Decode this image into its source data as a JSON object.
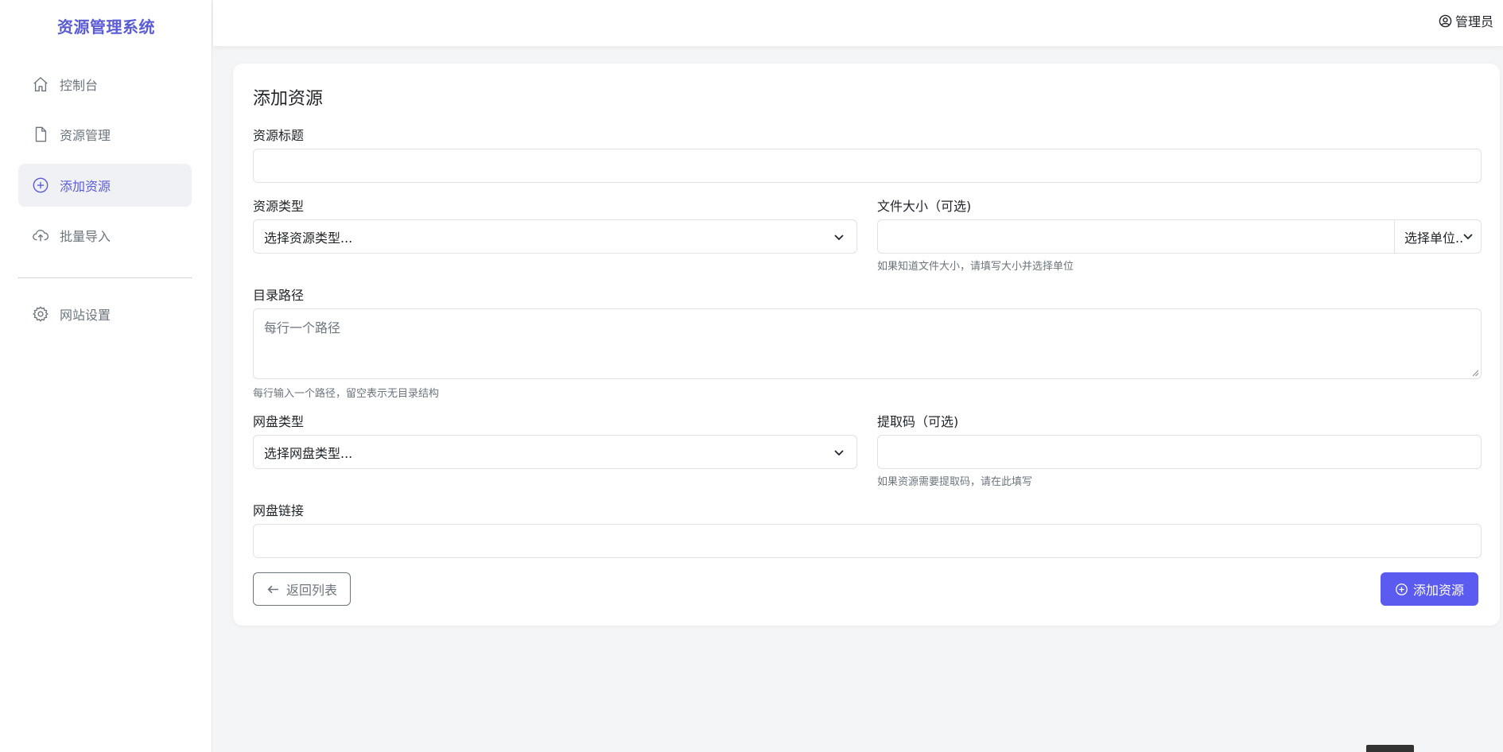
{
  "brand": "资源管理系统",
  "sidebar": {
    "items": [
      {
        "label": "控制台",
        "icon": "home-icon",
        "active": false
      },
      {
        "label": "资源管理",
        "icon": "file-icon",
        "active": false
      },
      {
        "label": "添加资源",
        "icon": "plus-circle-icon",
        "active": true
      },
      {
        "label": "批量导入",
        "icon": "cloud-upload-icon",
        "active": false
      },
      {
        "label": "网站设置",
        "icon": "gear-icon",
        "active": false
      }
    ]
  },
  "topbar": {
    "user": "管理员",
    "user_icon": "user-circle-icon"
  },
  "form": {
    "title": "添加资源",
    "resource_title": {
      "label": "资源标题",
      "value": ""
    },
    "resource_type": {
      "label": "资源类型",
      "selected": "选择资源类型..."
    },
    "file_size": {
      "label": "文件大小（可选)",
      "value": "",
      "unit_selected": "选择单位..",
      "hint": "如果知道文件大小，请填写大小并选择单位"
    },
    "dir_path": {
      "label": "目录路径",
      "placeholder": "每行一个路径",
      "hint": "每行输入一个路径，留空表示无目录结构"
    },
    "disk_type": {
      "label": "网盘类型",
      "selected": "选择网盘类型..."
    },
    "extract_code": {
      "label": "提取码（可选)",
      "value": "",
      "hint": "如果资源需要提取码，请在此填写"
    },
    "disk_link": {
      "label": "网盘链接",
      "value": ""
    },
    "back_button": "返回列表",
    "submit_button": "添加资源"
  },
  "colors": {
    "accent": "#5b5bf0",
    "brand": "#5b5bd6"
  }
}
